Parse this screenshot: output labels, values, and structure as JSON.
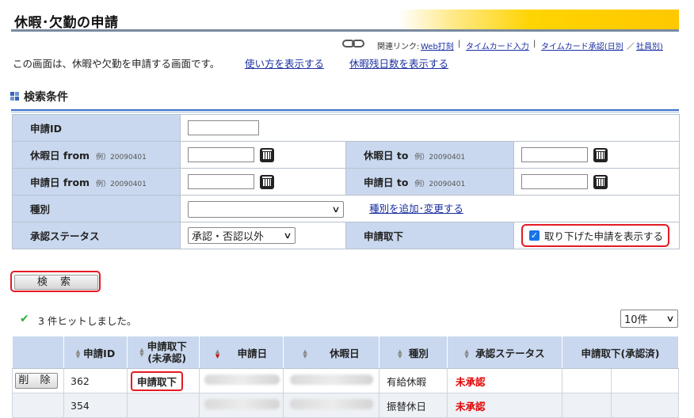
{
  "page": {
    "title": "休暇･欠勤の申請",
    "related_label": "関連リンク:",
    "related_links": [
      "Web打刻",
      "タイムカード入力",
      "タイムカード承認(日別",
      "社員別)"
    ],
    "related_seps": [
      "|",
      "|",
      "／"
    ],
    "description": "この画面は、休暇や欠勤を申請する画面です。",
    "usage_link": "使い方を表示する",
    "remaining_link": "休暇残日数を表示する"
  },
  "search": {
    "section_title": "検索条件",
    "request_id_label": "申請ID",
    "request_id_value": "",
    "leave_from_label": "休暇日 from",
    "leave_to_label": "休暇日 to",
    "apply_from_label": "申請日 from",
    "apply_to_label": "申請日 to",
    "example": "例）20090401",
    "type_label": "種別",
    "type_value": "",
    "type_link": "種別を追加･変更する",
    "status_label": "承認ステータス",
    "status_value": "承認・否認以外",
    "withdraw_label": "申請取下",
    "withdraw_checkbox_label": "取り下げた申請を表示する",
    "withdraw_checked": true,
    "search_button": "検 索"
  },
  "results": {
    "hit_text": "3 件ヒットしました。",
    "per_page": "10件",
    "headers": {
      "request_id": "申請ID",
      "withdraw_line1": "申請取下",
      "withdraw_line2": "(未承認)",
      "apply_date": "申請日",
      "leave_date": "休暇日",
      "type": "種別",
      "status": "承認ステータス",
      "withdraw_approved": "申請取下(承認済)"
    },
    "rows": [
      {
        "delete": "削 除",
        "id": "362",
        "withdraw": "申請取下",
        "type": "有給休暇",
        "status": "未承認"
      },
      {
        "delete": "",
        "id": "354",
        "withdraw": "",
        "type": "振替休日",
        "status": "未承認"
      }
    ]
  },
  "colors": {
    "header_bg": "#c9d8ee",
    "accent_yellow": "#ffd400",
    "link": "#1a2fa0",
    "status_red": "#e00000",
    "highlight_red": "#e31b23"
  }
}
